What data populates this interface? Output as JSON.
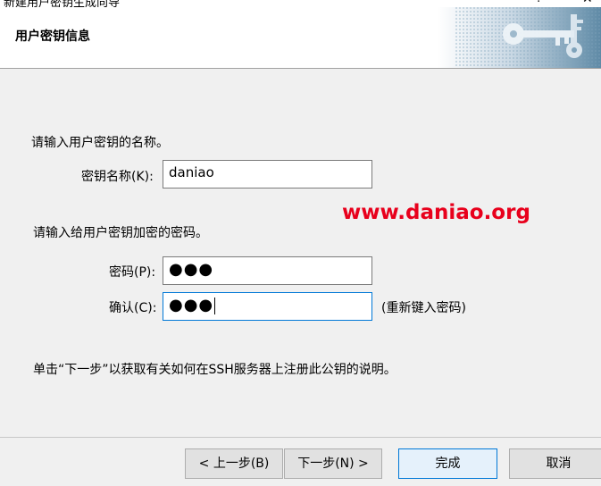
{
  "window": {
    "title": "新建用户密钥生成向导",
    "help_glyph": "?",
    "close_glyph": "✕"
  },
  "header": {
    "title": "用户密钥信息"
  },
  "form": {
    "name_prompt": "请输入用户密钥的名称。",
    "key_name_label": "密钥名称(K):",
    "key_name_value": "daniao",
    "password_prompt": "请输入给用户密钥加密的密码。",
    "password_label": "密码(P):",
    "password_value": "●●●",
    "confirm_label": "确认(C):",
    "confirm_value": "●●●",
    "confirm_hint": "(重新键入密码)",
    "info_text": "单击“下一步”以获取有关如何在SSH服务器上注册此公钥的说明。"
  },
  "watermark": "www.daniao.org",
  "buttons": {
    "back": "< 上一步(B)",
    "next": "下一步(N) >",
    "finish": "完成",
    "cancel": "取消"
  }
}
